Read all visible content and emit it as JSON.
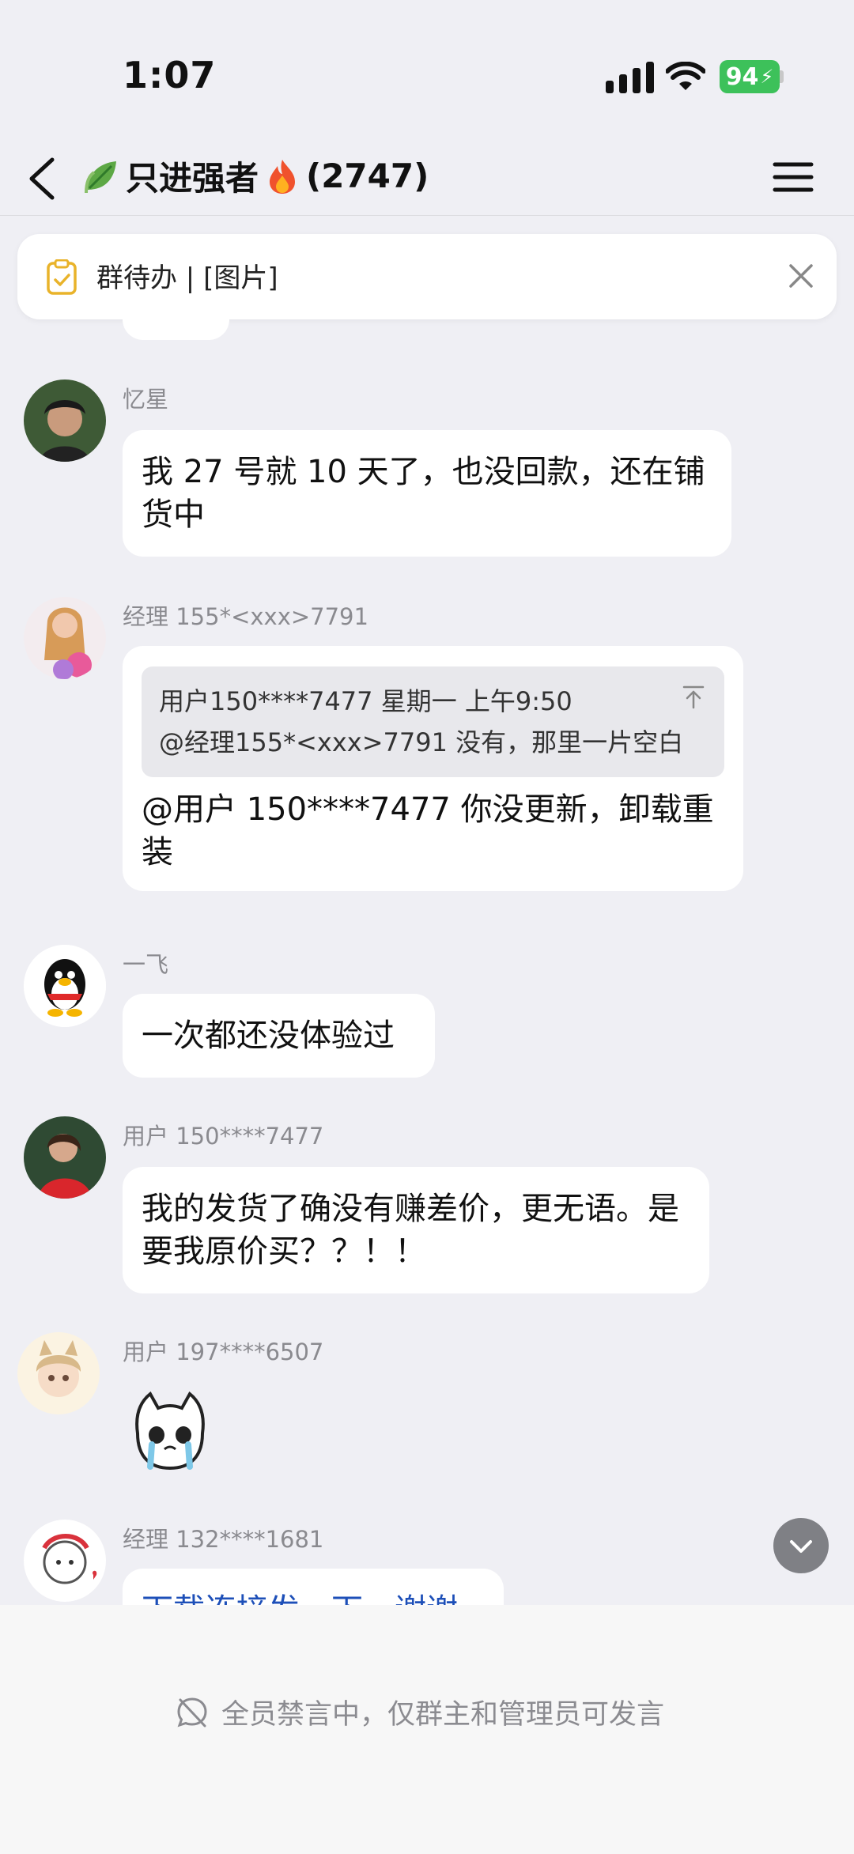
{
  "status_bar": {
    "time": "1:07",
    "battery": "94"
  },
  "header": {
    "title": "只进强者",
    "count": "(2747)"
  },
  "pinned": {
    "text": "群待办 | [图片]"
  },
  "messages": [
    {
      "sender": "忆星",
      "text": "我 27 号就 10 天了，也没回款，还在铺货中"
    },
    {
      "sender": "经理 155*<xxx>7791",
      "quote_line1": "用户150****7477  星期一  上午9:50",
      "quote_line2": "@经理155*<xxx>7791 没有，那里一片空白",
      "text": "@用户 150****7477 你没更新，卸载重装"
    },
    {
      "sender": "一飞",
      "text": "一次都还没体验过"
    },
    {
      "sender": "用户 150****7477",
      "text": "我的发货了确没有赚差价，更无语。是要我原价买？？！！"
    },
    {
      "sender": "用户 197****6507"
    },
    {
      "sender": "经理 132****1681",
      "text": "下载连接发一下，谢谢"
    }
  ],
  "bottom_bar": {
    "mute_text": "全员禁言中，仅群主和管理员可发言"
  },
  "colors": {
    "background": "#efeff4",
    "battery": "#3dc15a",
    "bubble": "#ffffff",
    "link": "#1d4fb8"
  }
}
